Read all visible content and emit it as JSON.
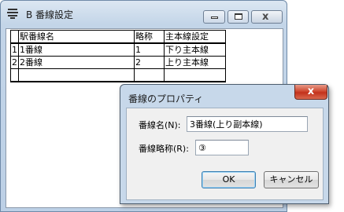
{
  "main_window": {
    "title": "B 番線設定",
    "table": {
      "headers": [
        "",
        "駅番線名",
        "略称",
        "主本線設定"
      ],
      "rows": [
        {
          "num": "1",
          "name": "1番線",
          "abbr": "1",
          "main_line": "下り主本線"
        },
        {
          "num": "2",
          "name": "2番線",
          "abbr": "2",
          "main_line": "上り主本線"
        },
        {
          "num": "",
          "name": "",
          "abbr": "",
          "main_line": ""
        }
      ]
    }
  },
  "dialog": {
    "title": "番線のプロパティ",
    "name_label": "番線名(N):",
    "name_value": "3番線(上り副本線)",
    "abbr_label": "番線略称(R):",
    "abbr_value": "③",
    "ok_label": "OK",
    "cancel_label": "キャンセル",
    "close_glyph": "x"
  },
  "icons": {
    "app": "app-settings-icon",
    "minimize": "minimize-icon",
    "maximize": "maximize-icon",
    "close": "close-icon"
  },
  "colors": {
    "titlebar": "#c3d5e8",
    "dialog_close": "#c3311b",
    "dialog_face": "#f0f0f0"
  }
}
